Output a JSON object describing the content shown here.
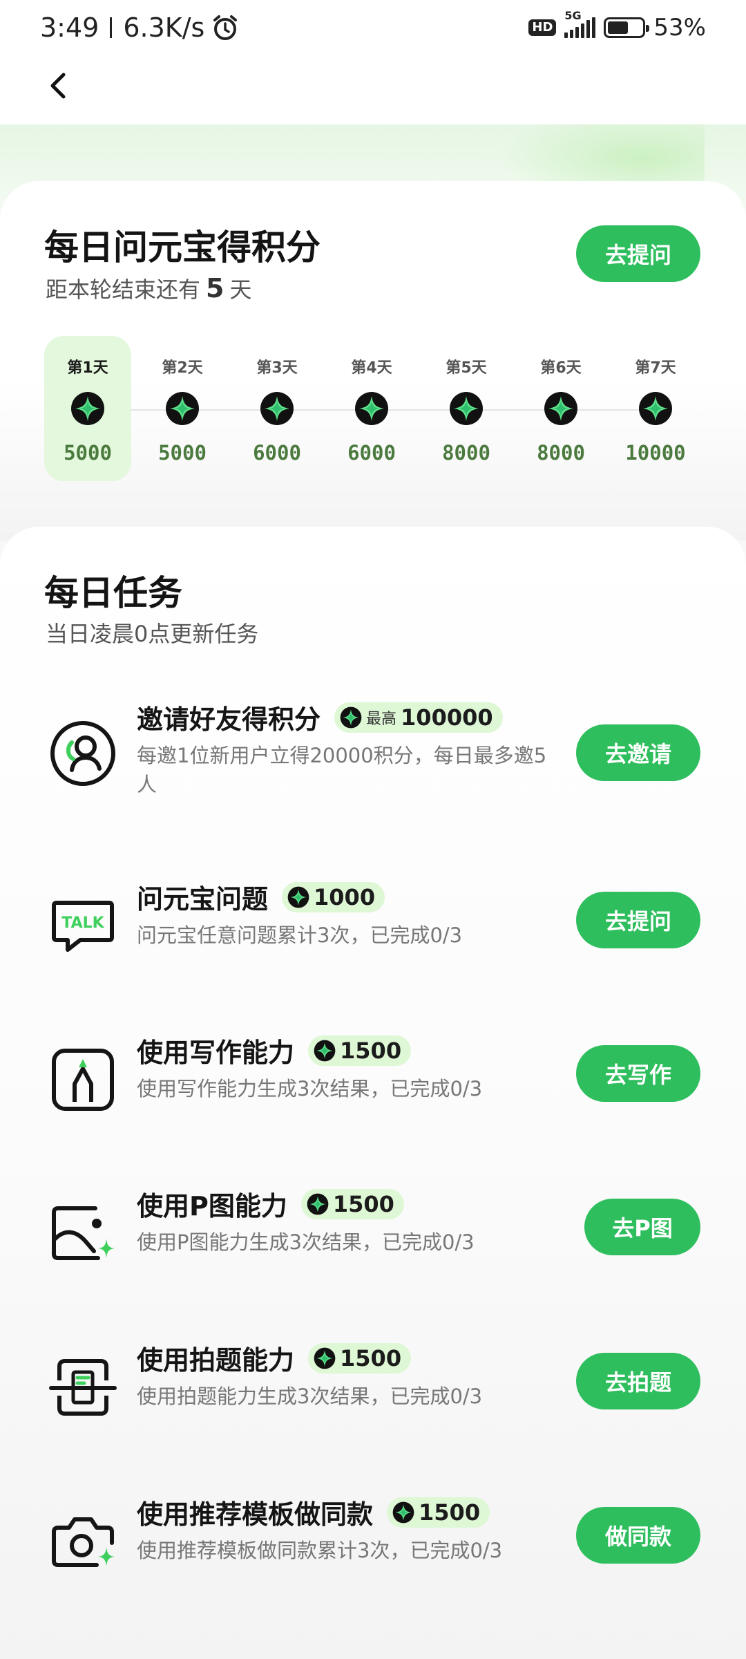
{
  "status_bar": {
    "time": "3:49",
    "speed": "6.3K/s",
    "network": "5G",
    "hd": "HD",
    "battery": "53%",
    "battery_level": 0.53
  },
  "checkin": {
    "title": "每日问元宝得积分",
    "subtitle_prefix": "距本轮结束还有",
    "days_left": "5",
    "subtitle_suffix": "天",
    "button": "去提问",
    "days": [
      {
        "label": "第1天",
        "points": "5000",
        "active": true
      },
      {
        "label": "第2天",
        "points": "5000",
        "active": false
      },
      {
        "label": "第3天",
        "points": "6000",
        "active": false
      },
      {
        "label": "第4天",
        "points": "6000",
        "active": false
      },
      {
        "label": "第5天",
        "points": "8000",
        "active": false
      },
      {
        "label": "第6天",
        "points": "8000",
        "active": false
      },
      {
        "label": "第7天",
        "points": "10000",
        "active": false
      }
    ]
  },
  "tasks_section": {
    "title": "每日任务",
    "subtitle": "当日凌晨0点更新任务",
    "tasks": [
      {
        "icon": "invite-friend-icon",
        "title": "邀请好友得积分",
        "reward_prefix": "最高",
        "reward": "100000",
        "desc": "每邀1位新用户立得20000积分，每日最多邀5人",
        "button": "去邀请"
      },
      {
        "icon": "talk-bubble-icon",
        "title": "问元宝问题",
        "reward_prefix": "",
        "reward": "1000",
        "desc": "问元宝任意问题累计3次，已完成0/3",
        "button": "去提问"
      },
      {
        "icon": "writing-icon",
        "title": "使用写作能力",
        "reward_prefix": "",
        "reward": "1500",
        "desc": "使用写作能力生成3次结果，已完成0/3",
        "button": "去写作"
      },
      {
        "icon": "image-edit-icon",
        "title": "使用P图能力",
        "reward_prefix": "",
        "reward": "1500",
        "desc": "使用P图能力生成3次结果，已完成0/3",
        "button": "去P图"
      },
      {
        "icon": "photo-question-icon",
        "title": "使用拍题能力",
        "reward_prefix": "",
        "reward": "1500",
        "desc": "使用拍题能力生成3次结果，已完成0/3",
        "button": "去拍题"
      },
      {
        "icon": "camera-template-icon",
        "title": "使用推荐模板做同款",
        "reward_prefix": "",
        "reward": "1500",
        "desc": "使用推荐模板做同款累计3次，已完成0/3",
        "button": "做同款"
      }
    ]
  },
  "colors": {
    "accent": "#2fbe5e",
    "reward_bg": "#def7d5",
    "day_active_bg": "#e3f8dc",
    "points_text": "#4b7a3e"
  }
}
